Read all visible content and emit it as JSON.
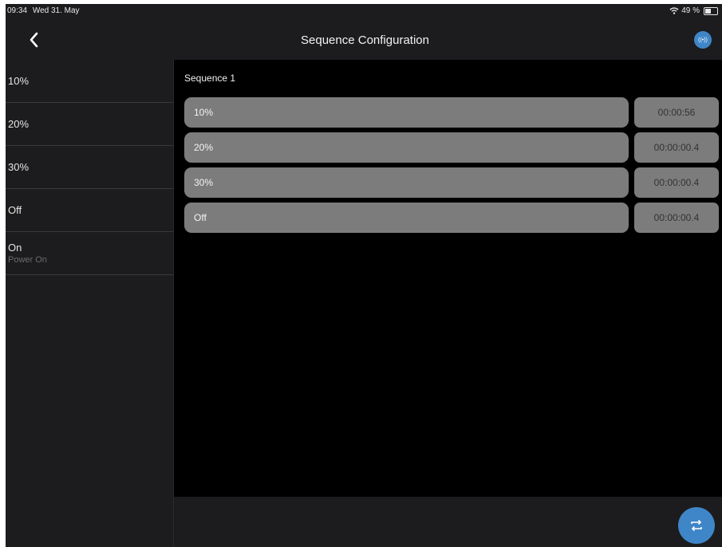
{
  "status_bar": {
    "time": "09:34",
    "date": "Wed 31. May",
    "battery": "49 %",
    "battery_level": 0.49
  },
  "nav": {
    "title": "Sequence Configuration",
    "back_icon": "chevron-left-icon",
    "status_icon": "broadcast-icon",
    "status_text": "((•))"
  },
  "sidebar": {
    "items": [
      {
        "label": "10%",
        "sub": ""
      },
      {
        "label": "20%",
        "sub": ""
      },
      {
        "label": "30%",
        "sub": ""
      },
      {
        "label": "Off",
        "sub": ""
      },
      {
        "label": "On",
        "sub": "Power On"
      }
    ]
  },
  "sequence": {
    "title": "Sequence 1",
    "steps": [
      {
        "name": "10%",
        "time": "00:00:56"
      },
      {
        "name": "20%",
        "time": "00:00:00.4"
      },
      {
        "name": "30%",
        "time": "00:00:00.4"
      },
      {
        "name": "Off",
        "time": "00:00:00.4"
      }
    ]
  },
  "fab": {
    "icon": "repeat-icon"
  },
  "colors": {
    "accent": "#3f86c8",
    "panel": "#1c1c1e",
    "background": "#000000",
    "step_fill": "#7c7c7c"
  }
}
